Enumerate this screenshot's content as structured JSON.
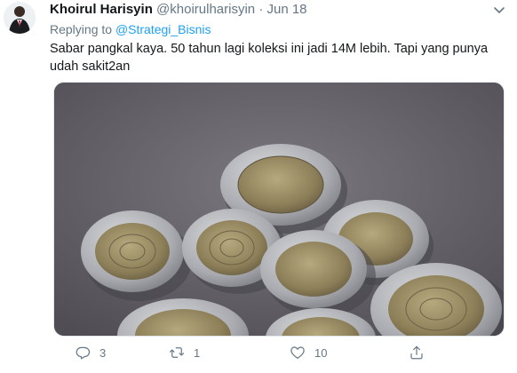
{
  "tweet": {
    "author_name": "Khoirul Harisyin",
    "author_handle": "@khoirulharisyin",
    "separator": "·",
    "date": "Jun 18",
    "replying_prefix": "Replying to",
    "replying_to": "@Strategi_Bisnis",
    "text": "Sabar pangkal kaya. 50 tahun lagi koleksi ini jadi 14M lebih. Tapi yang punya udah sakit2an"
  },
  "actions": {
    "reply_count": "3",
    "retweet_count": "1",
    "like_count": "10"
  },
  "icons": {
    "reply": "reply-icon",
    "retweet": "retweet-icon",
    "like": "heart-icon",
    "share": "share-icon",
    "more": "chevron-down-icon"
  },
  "colors": {
    "link": "#1da1f2",
    "secondary_text": "#657786"
  }
}
